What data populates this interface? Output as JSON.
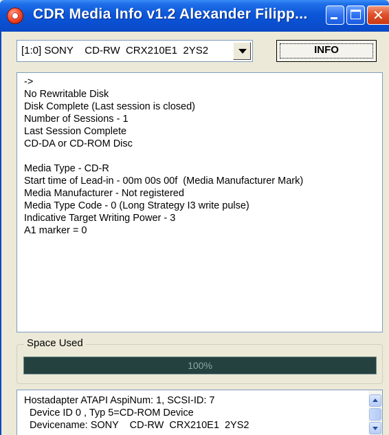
{
  "window": {
    "title": "CDR Media Info  v1.2    Alexander Filipp..."
  },
  "toolbar": {
    "drive_selected": "[1:0] SONY    CD-RW  CRX210E1  2YS2",
    "info_button_label": "INFO"
  },
  "info": {
    "lines": [
      "->",
      "No Rewritable Disk",
      "Disk Complete (Last session is closed)",
      "Number of Sessions - 1",
      "Last Session Complete",
      "CD-DA or CD-ROM Disc",
      "",
      "Media Type - CD-R",
      "Start time of Lead-in - 00m 00s 00f  (Media Manufacturer Mark)",
      "Media Manufacturer - Not registered",
      "Media Type Code - 0 (Long Strategy I3 write pulse)",
      "Indicative Target Writing Power - 3",
      "A1 marker = 0"
    ]
  },
  "space_used": {
    "legend": "Space Used",
    "percent_text": "100%",
    "fraction": 1.0
  },
  "log": {
    "lines": [
      "Hostadapter ATAPI AspiNum: 1, SCSI-ID: 7",
      "  Device ID 0 , Typ 5=CD-ROM Device",
      "  Devicename: SONY    CD-RW  CRX210E1  2YS2"
    ]
  },
  "colors": {
    "titlebar": "#0a4fd0",
    "progress_bg": "#2b4442",
    "progress_text": "#8aa6a4"
  }
}
